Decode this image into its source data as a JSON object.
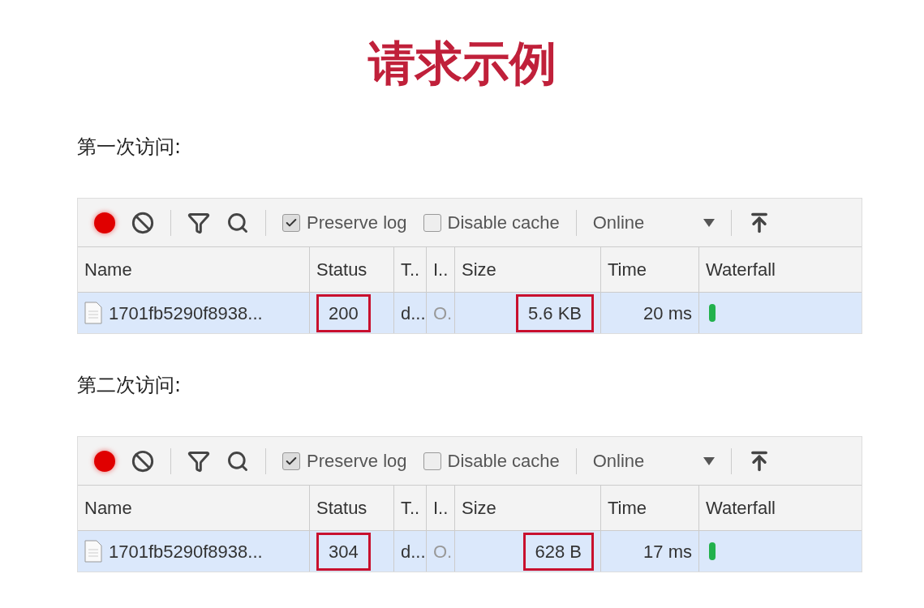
{
  "title": "请求示例",
  "sections": [
    {
      "label": "第一次访问:",
      "toolbar": {
        "recording": true,
        "preserve_log": {
          "label": "Preserve log",
          "checked": true
        },
        "disable_cache": {
          "label": "Disable cache",
          "checked": false
        },
        "throttling": "Online"
      },
      "columns": [
        "Name",
        "Status",
        "T..",
        "I..",
        "Size",
        "Time",
        "Waterfall"
      ],
      "rows": [
        {
          "selected": true,
          "cells": [
            {
              "text": "1701fb5290f8938...",
              "highlighted": false
            },
            {
              "text": "200",
              "highlighted": true
            },
            {
              "text": "d...",
              "highlighted": false
            },
            {
              "text": "O.",
              "highlighted": false
            },
            {
              "text": "5.6 KB",
              "highlighted": true
            },
            {
              "text": "20 ms",
              "highlighted": false
            }
          ]
        }
      ]
    },
    {
      "label": "第二次访问:",
      "toolbar": {
        "recording": true,
        "preserve_log": {
          "label": "Preserve log",
          "checked": true
        },
        "disable_cache": {
          "label": "Disable cache",
          "checked": false
        },
        "throttling": "Online"
      },
      "columns": [
        "Name",
        "Status",
        "T..",
        "I..",
        "Size",
        "Time",
        "Waterfall"
      ],
      "rows": [
        {
          "selected": true,
          "cells": [
            {
              "text": "1701fb5290f8938...",
              "highlighted": false
            },
            {
              "text": "304",
              "highlighted": true
            },
            {
              "text": "d...",
              "highlighted": false
            },
            {
              "text": "O.",
              "highlighted": false
            },
            {
              "text": "628 B",
              "highlighted": true
            },
            {
              "text": "17 ms",
              "highlighted": false
            }
          ]
        }
      ]
    }
  ]
}
